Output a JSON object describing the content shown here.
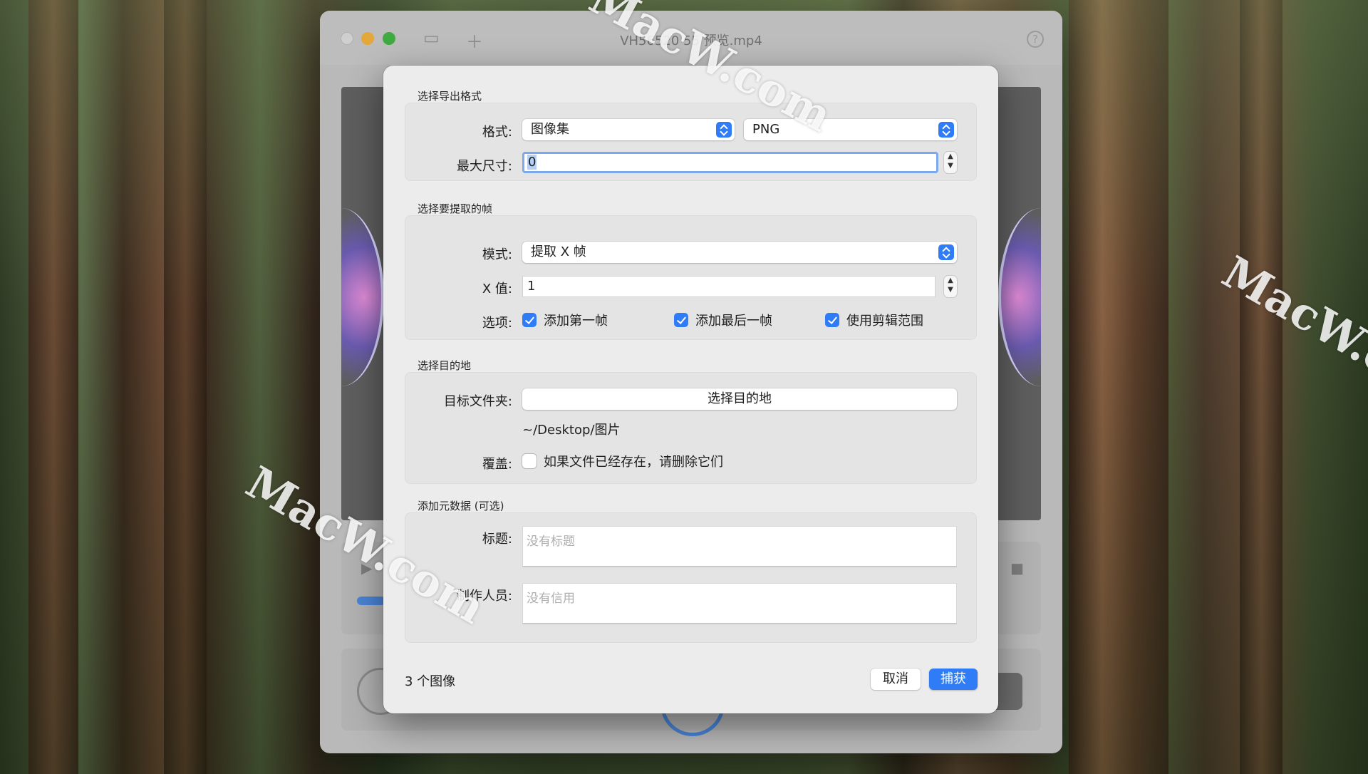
{
  "window": {
    "title": "VH56520 55 预览.mp4"
  },
  "watermark": "MacW.com",
  "sections": {
    "export_format": "选择导出格式",
    "frames": "选择要提取的帧",
    "destination": "选择目的地",
    "metadata": "添加元数据 (可选)"
  },
  "export": {
    "format_label": "格式:",
    "format_value": "图像集",
    "type_value": "PNG",
    "max_size_label": "最大尺寸:",
    "max_size_value": "0"
  },
  "frames": {
    "mode_label": "模式:",
    "mode_value": "提取 X 帧",
    "x_label": "X 值:",
    "x_value": "1",
    "options_label": "选项:",
    "options": [
      {
        "label": "添加第一帧",
        "checked": true
      },
      {
        "label": "添加最后一帧",
        "checked": true
      },
      {
        "label": "使用剪辑范围",
        "checked": true
      }
    ]
  },
  "destination": {
    "folder_label": "目标文件夹:",
    "choose_button": "选择目的地",
    "path": "~/Desktop/图片",
    "overwrite_label": "覆盖:",
    "overwrite_option": "如果文件已经存在，请删除它们",
    "overwrite_checked": false
  },
  "metadata": {
    "title_label": "标题:",
    "title_placeholder": "没有标题",
    "credits_label": "制作人员:",
    "credits_placeholder": "没有信用"
  },
  "footer": {
    "count": "3 个图像",
    "cancel_button": "取消",
    "capture_button": "捕获"
  },
  "colors": {
    "accent": "#2f7cf6",
    "sheet_background": "#ececec"
  }
}
